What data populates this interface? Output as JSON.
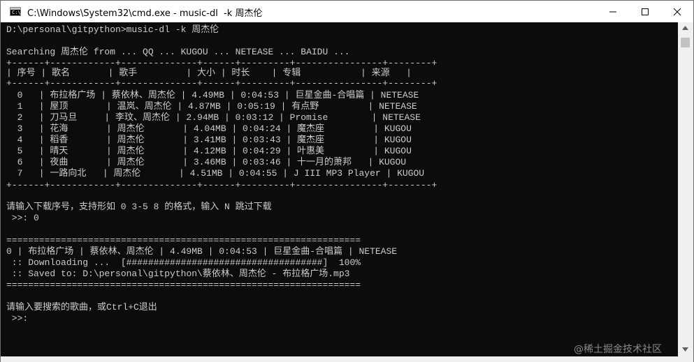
{
  "window": {
    "title": "C:\\Windows\\System32\\cmd.exe - music-dl  -k 周杰伦",
    "icon": "cmd-icon",
    "controls": {
      "minimize": "minimize-icon",
      "maximize": "maximize-icon",
      "close": "close-icon"
    }
  },
  "console": {
    "lines": [
      "D:\\personal\\gitpython>music-dl -k 周杰伦",
      "",
      "Searching 周杰伦 from ... QQ ... KUGOU ... NETEASE ... BAIDU ...",
      "+------+------------+--------------+------+---------+----------------+--------+",
      "| 序号 | 歌名       | 歌手         | 大小 | 时长    | 专辑           | 来源   |",
      "+------+------------+--------------+------+---------+----------------+--------+",
      "  0   | 布拉格广场 | 蔡依林、周杰伦 | 4.49MB | 0:04:53 | 巨星金曲-合唱篇 | NETEASE",
      "  1   | 屋顶       | 温岚、周杰伦 | 4.87MB | 0:05:19 | 有点野         | NETEASE",
      "  2   | 刀马旦     | 李玟、周杰伦 | 2.94MB | 0:03:12 | Promise        | NETEASE",
      "  3   | 花海       | 周杰伦       | 4.04MB | 0:04:24 | 魔杰座         | KUGOU",
      "  4   | 稻香       | 周杰伦       | 3.41MB | 0:03:43 | 魔杰座         | KUGOU",
      "  5   | 晴天       | 周杰伦       | 4.12MB | 0:04:29 | 叶惠美         | KUGOU",
      "  6   | 夜曲       | 周杰伦       | 3.46MB | 0:03:46 | 十一月的萧邦   | KUGOU",
      "  7   | 一路向北   | 周杰伦       | 4.51MB | 0:04:55 | J III MP3 Player | KUGOU",
      "+------+------------+--------------+------+---------+----------------+--------+",
      "",
      "请输入下载序号，支持形如 0 3-5 8 的格式，输入 N 跳过下载",
      " >>: 0",
      "",
      "=================================================================",
      "0 | 布拉格广场 | 蔡依林、周杰伦 | 4.49MB | 0:04:53 | 巨星金曲-合唱篇 | NETEASE",
      " :: Downloading ...  [####################################]  100%",
      " :: Saved to: D:\\personal\\gitpython\\蔡依林、周杰伦 - 布拉格广场.mp3",
      "=================================================================",
      "",
      "请输入要搜索的歌曲，或Ctrl+C退出",
      " >>:"
    ]
  },
  "watermark": "@稀土掘金技术社区"
}
